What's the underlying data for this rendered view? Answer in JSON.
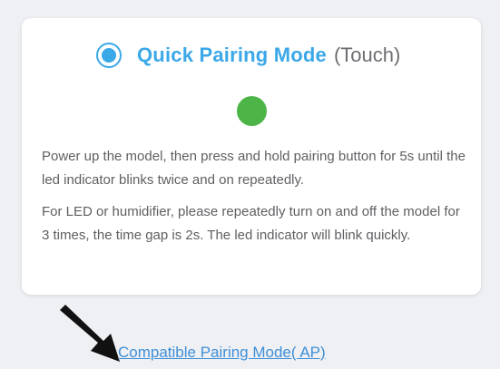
{
  "pairing_card": {
    "mode_title": "Quick Pairing Mode",
    "mode_subtitle": "(Touch)",
    "selected": true,
    "led_color": "#4db548",
    "instruction_1": "Power up the model, then press and hold pairing button for 5s until the led indicator blinks twice and on repeatedly.",
    "instruction_2": "For LED or humidifier, please repeatedly turn on and off the model for 3 times, the time gap is 2s. The led indicator will blink quickly."
  },
  "alt_mode_link": "Compatible Pairing Mode( AP)",
  "colors": {
    "accent": "#3ba8e8",
    "link": "#3f8fd6",
    "background": "#eff0f4",
    "card": "#ffffff"
  },
  "icons": {
    "radio": "radio-selected-icon",
    "led": "led-indicator-icon",
    "arrow": "pointer-arrow-icon"
  }
}
